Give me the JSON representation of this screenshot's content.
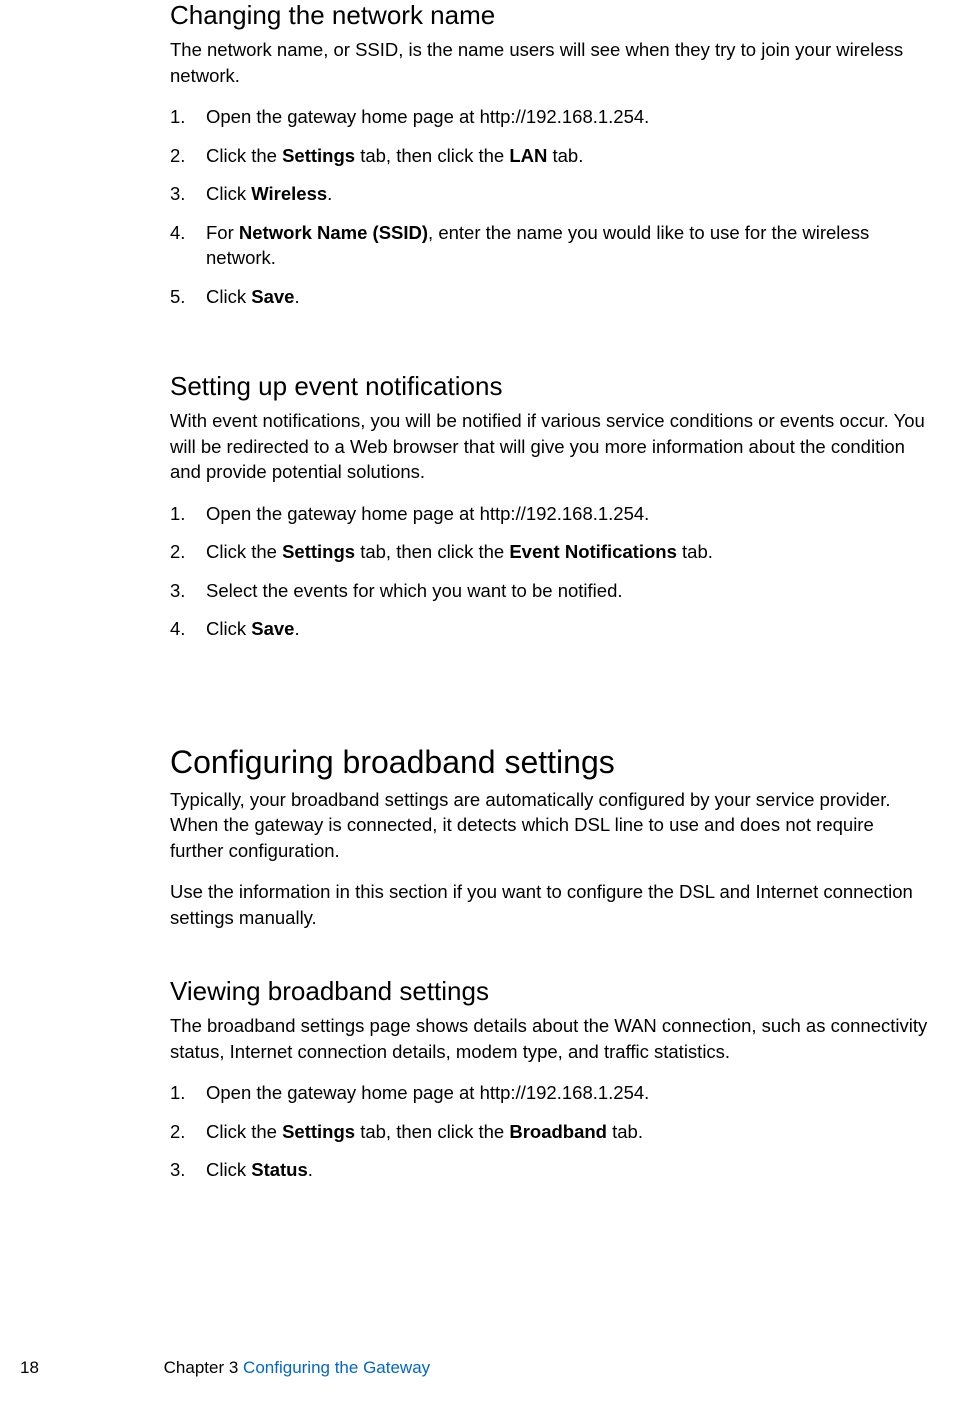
{
  "section1": {
    "heading": "Changing the network name",
    "intro": "The network name, or SSID, is the name users will see when they try to join your wireless network.",
    "steps": [
      {
        "pre": "Open the gateway home page at http://192.168.1.254."
      },
      {
        "pre": "Click the ",
        "b1": "Settings",
        "mid": " tab, then click the ",
        "b2": "LAN",
        "post": " tab."
      },
      {
        "pre": "Click ",
        "b1": "Wireless",
        "post": "."
      },
      {
        "pre": "For ",
        "b1": "Network Name (SSID)",
        "post": ", enter the name you would like to use for the wireless network."
      },
      {
        "pre": "Click ",
        "b1": "Save",
        "post": "."
      }
    ]
  },
  "section2": {
    "heading": "Setting up event notifications",
    "intro": "With event notifications, you will be notified if various service conditions or events occur. You will be redirected to a Web browser that will give you more information about the condition and provide potential solutions.",
    "steps": [
      {
        "pre": "Open the gateway home page at http://192.168.1.254."
      },
      {
        "pre": "Click the ",
        "b1": "Settings",
        "mid": " tab, then click the ",
        "b2": "Event Notifications",
        "post": " tab."
      },
      {
        "pre": "Select the events for which you want to be notified."
      },
      {
        "pre": "Click ",
        "b1": "Save",
        "post": "."
      }
    ]
  },
  "section3": {
    "heading": "Configuring broadband settings",
    "intro1": "Typically, your broadband settings are automatically configured by your service provider. When the gateway is connected, it detects which DSL line to use and does not require further configuration.",
    "intro2": "Use the information in this section if you want to configure the DSL and Internet connection settings manually."
  },
  "section4": {
    "heading": "Viewing broadband settings",
    "intro": "The broadband settings page shows details about the WAN connection, such as connectivity status, Internet connection details, modem type, and traffic statistics.",
    "steps": [
      {
        "pre": "Open the gateway home page at http://192.168.1.254."
      },
      {
        "pre": "Click the ",
        "b1": "Settings",
        "mid": " tab, then click the ",
        "b2": "Broadband",
        "post": " tab."
      },
      {
        "pre": "Click ",
        "b1": "Status",
        "post": "."
      }
    ]
  },
  "footer": {
    "page": "18",
    "chapter": "Chapter 3  ",
    "title": "Configuring the Gateway"
  }
}
